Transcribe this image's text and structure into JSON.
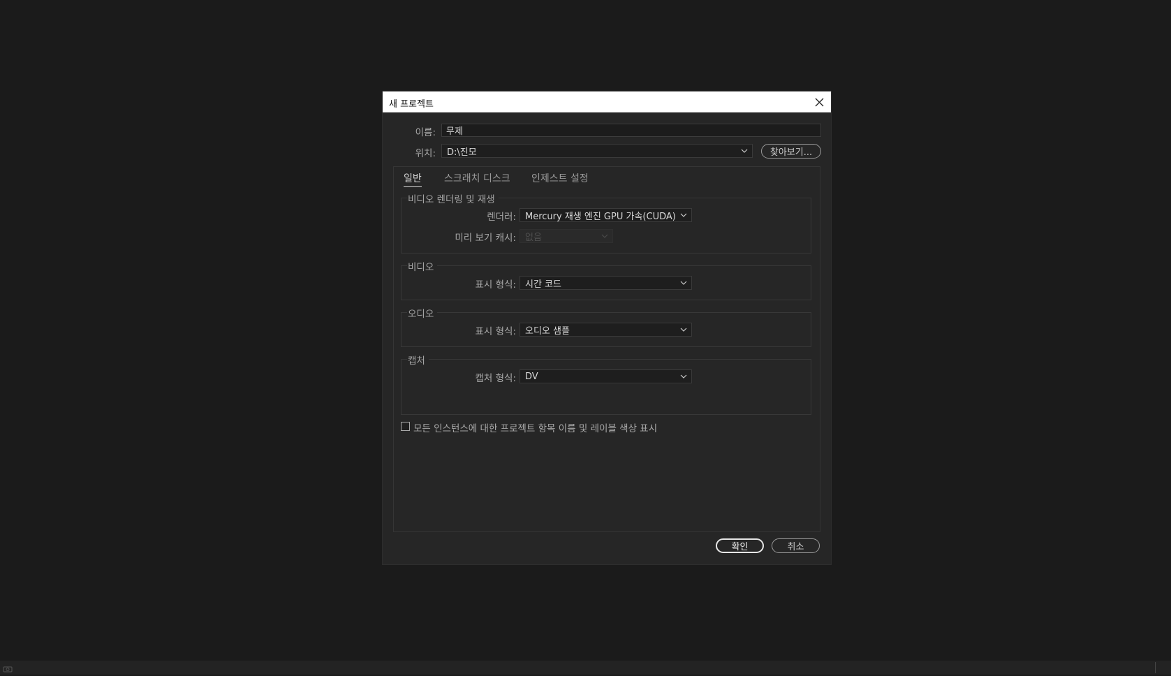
{
  "dialog": {
    "title": "새 프로젝트",
    "name_label": "이름:",
    "name_value": "무제",
    "location_label": "위치:",
    "location_value": "D:\\진모",
    "browse_label": "찾아보기...",
    "ok_label": "확인",
    "cancel_label": "취소"
  },
  "tabs": [
    {
      "label": "일반",
      "active": true
    },
    {
      "label": "스크래치 디스크",
      "active": false
    },
    {
      "label": "인제스트 설정",
      "active": false
    }
  ],
  "groups": {
    "rendering": {
      "title": "비디오 렌더링 및 재생",
      "renderer_label": "렌더러:",
      "renderer_value": "Mercury 재생 엔진 GPU 가속(CUDA)",
      "preview_cache_label": "미리 보기 캐시:",
      "preview_cache_value": "없음"
    },
    "video": {
      "title": "비디오",
      "display_label": "표시 형식:",
      "display_value": "시간 코드"
    },
    "audio": {
      "title": "오디오",
      "display_label": "표시 형식:",
      "display_value": "오디오 샘플"
    },
    "capture": {
      "title": "캡처",
      "format_label": "캡처 형식:",
      "format_value": "DV"
    }
  },
  "checkbox": {
    "label": "모든 인스턴스에 대한 프로젝트 항목 이름 및 레이블 색상 표시",
    "checked": false
  },
  "icons": {
    "close": "close-icon",
    "chevron": "chevron-down-icon",
    "status": "status-icon"
  },
  "colors": {
    "background": "#1b1b1b",
    "dialog": "#262626",
    "titlebar": "#ffffff"
  }
}
